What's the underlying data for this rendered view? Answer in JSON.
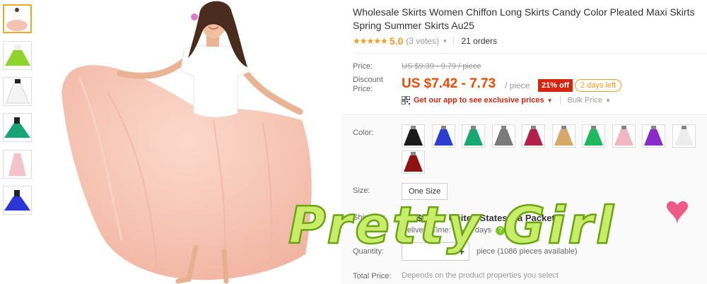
{
  "product": {
    "title": "Wholesale Skirts Women Chiffon Long Skirts Candy Color Pleated Maxi Skirts Spring Summer Skirts Au25",
    "stars": "★★★★★",
    "rating": "5.0",
    "votes": "(3 votes)",
    "orders": "21 orders"
  },
  "price": {
    "label": "Price:",
    "original": "US $9.39 - 9.79 / piece",
    "discount_label_1": "Discount",
    "discount_label_2": "Price:",
    "discount": "US $7.42 - 7.73",
    "per": "/ piece",
    "off_badge": "21% off",
    "days_left": "2 days left",
    "app_link": "Get our app to see exclusive prices",
    "bulk": "Bulk Price"
  },
  "options": {
    "color_label": "Color:",
    "colors": [
      {
        "name": "black",
        "color": "#1a1a1a"
      },
      {
        "name": "royal-blue",
        "color": "#2a3fd0"
      },
      {
        "name": "green",
        "color": "#16a86e"
      },
      {
        "name": "grey",
        "color": "#7a7a7a"
      },
      {
        "name": "wine-red",
        "color": "#b3204a"
      },
      {
        "name": "khaki",
        "color": "#d6a86a"
      },
      {
        "name": "light-green",
        "color": "#1fb860"
      },
      {
        "name": "pink",
        "color": "#f1b8c4"
      },
      {
        "name": "purple",
        "color": "#8a2bc9"
      },
      {
        "name": "white",
        "color": "#ececec"
      },
      {
        "name": "burgundy",
        "color": "#8f1212"
      }
    ],
    "size_label": "Size:",
    "size_value": "One Size"
  },
  "shipping": {
    "label": "Shipping:",
    "price": "US $1.2  to United States via Packet",
    "delivery": "Delivery Time: 12-20 days",
    "help": "?"
  },
  "quantity": {
    "label": "Quantity:",
    "plus": "+",
    "note": "piece (1086 pieces available)"
  },
  "total": {
    "label": "Total Price:",
    "note": "Depends on the product properties you select"
  },
  "overlay": {
    "text": "Pretty Girl"
  },
  "colors": {
    "accent": "#f04a00",
    "star": "#f59a23",
    "badge": "#d6250f",
    "overlay_fill": "#c9ec6a",
    "overlay_stroke": "#6aa510",
    "heart": "#f05a8a"
  }
}
